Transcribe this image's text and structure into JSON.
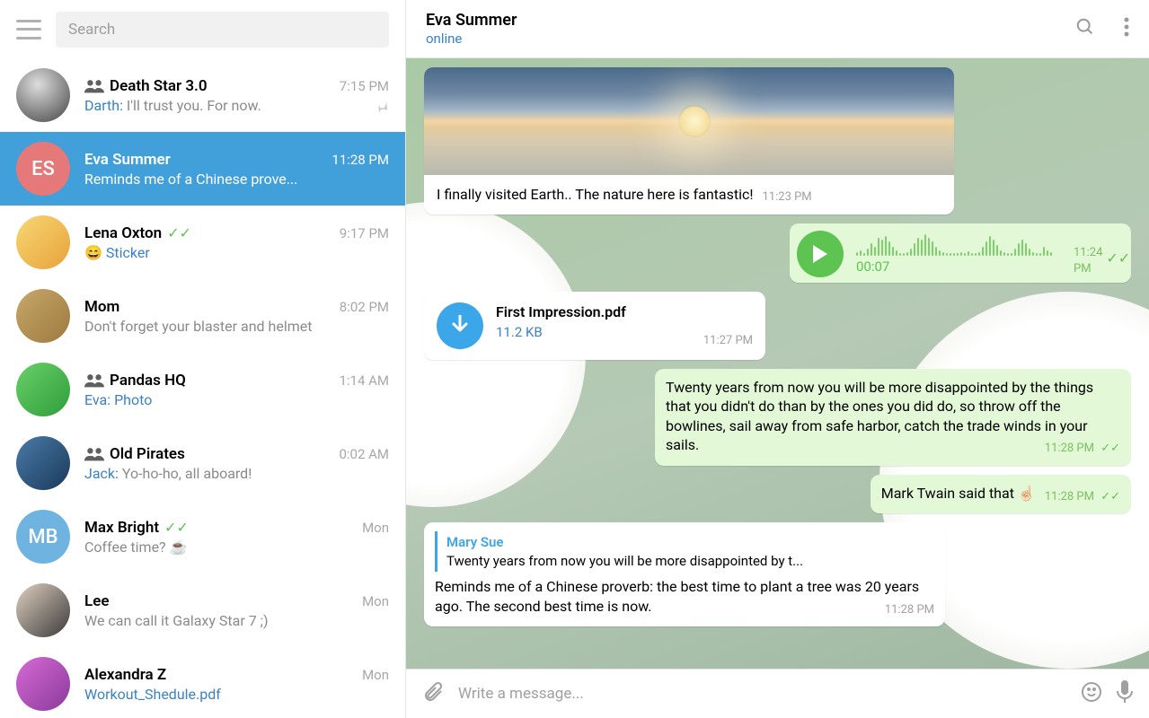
{
  "search": {
    "placeholder": "Search"
  },
  "header": {
    "name": "Eva Summer",
    "status": "online"
  },
  "chats": [
    {
      "name": "Death Star 3.0",
      "time": "7:15 PM",
      "sender": "Darth:",
      "preview": " I'll trust you. For now.",
      "group": true,
      "pinned": true
    },
    {
      "name": "Eva Summer",
      "time": "11:28 PM",
      "preview": "Reminds me of a Chinese prove...",
      "initials": "ES",
      "selected": true
    },
    {
      "name": "Lena Oxton",
      "time": "9:17 PM",
      "preview": "Sticker",
      "emoji": "😄",
      "read": true,
      "linkPreview": true
    },
    {
      "name": "Mom",
      "time": "8:02 PM",
      "preview": "Don't forget your blaster and helmet"
    },
    {
      "name": "Pandas HQ",
      "time": "1:14 AM",
      "sender": "Eva:",
      "preview": " Photo",
      "group": true,
      "linkPreview": true
    },
    {
      "name": "Old Pirates",
      "time": "0:02 AM",
      "sender": "Jack:",
      "preview": " Yo-ho-ho, all aboard!",
      "group": true
    },
    {
      "name": "Max Bright",
      "time": "Mon",
      "preview": "Coffee time? ☕",
      "initials": "MB",
      "read": true
    },
    {
      "name": "Lee",
      "time": "Mon",
      "preview": "We can call it Galaxy Star 7 ;)"
    },
    {
      "name": "Alexandra Z",
      "time": "Mon",
      "preview": "Workout_Shedule.pdf",
      "linkPreview": true
    }
  ],
  "messages": {
    "photo_caption": "I finally visited Earth.. The nature here is fantastic!",
    "photo_time": "11:23 PM",
    "voice_duration": "00:07",
    "voice_time": "11:24 PM",
    "file_name": "First Impression.pdf",
    "file_size": "11.2 KB",
    "file_time": "11:27 PM",
    "quote": "Twenty years from now you will be more disappointed by the things that you didn't do than by the ones you did do, so throw off the bowlines, sail away from safe harbor, catch the trade winds in your sails.",
    "quote_time": "11:28 PM",
    "twain": "Mark Twain said that ☝🏻",
    "twain_time": "11:28 PM",
    "reply_name": "Mary Sue",
    "reply_quote": "Twenty years from now you will be more disappointed by t...",
    "reply_body": "Reminds me of a Chinese proverb: the best time to plant a tree was 20 years ago. The second best time is now.",
    "reply_time": "11:28 PM"
  },
  "compose": {
    "placeholder": "Write a message..."
  }
}
